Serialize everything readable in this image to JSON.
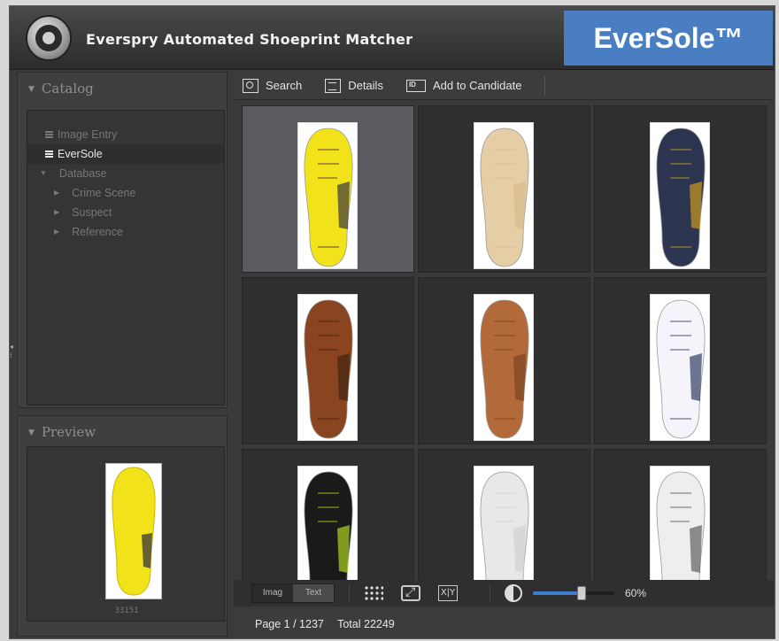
{
  "header": {
    "app_title": "Everspry Automated Shoeprint Matcher",
    "brand": "EverSole™"
  },
  "catalog": {
    "title": "Catalog",
    "items": [
      {
        "label": "Image Entry",
        "type": "db",
        "selected": false
      },
      {
        "label": "EverSole",
        "type": "db",
        "selected": true
      },
      {
        "label": "Database",
        "type": "group",
        "selected": false
      },
      {
        "label": "Crime Scene",
        "type": "child",
        "selected": false
      },
      {
        "label": "Suspect",
        "type": "child",
        "selected": false
      },
      {
        "label": "Reference",
        "type": "child",
        "selected": false
      }
    ]
  },
  "preview": {
    "title": "Preview",
    "caption": "33151"
  },
  "toolbar": {
    "search": "Search",
    "details": "Details",
    "add_candidate": "Add to Candidate"
  },
  "grid": {
    "items": [
      {
        "name": "shoeprint-1",
        "sole": "#f2e21a",
        "accent": "#2b2b40",
        "selected": true
      },
      {
        "name": "shoeprint-2",
        "sole": "#e5cda6",
        "accent": "#d9b88a",
        "selected": false
      },
      {
        "name": "shoeprint-3",
        "sole": "#2b3550",
        "accent": "#d8a018",
        "selected": false
      },
      {
        "name": "shoeprint-4",
        "sole": "#8a4520",
        "accent": "#3a2010",
        "selected": false
      },
      {
        "name": "shoeprint-5",
        "sole": "#b26a3a",
        "accent": "#7a4020",
        "selected": false
      },
      {
        "name": "shoeprint-6",
        "sole": "#f4f4fa",
        "accent": "#25305a",
        "selected": false
      },
      {
        "name": "shoeprint-7",
        "sole": "#1a1a1a",
        "accent": "#b7e020",
        "selected": false
      },
      {
        "name": "shoeprint-8",
        "sole": "#e8e8e8",
        "accent": "#cfcfcf",
        "selected": false
      },
      {
        "name": "shoeprint-9",
        "sole": "#eeeeee",
        "accent": "#555555",
        "selected": false
      }
    ]
  },
  "view_toggle": {
    "image": "Imag",
    "text": "Text"
  },
  "zoom": {
    "label": "60%",
    "value": 0.6
  },
  "status": {
    "page": "Page 1 / 1237",
    "total": "Total 22249"
  },
  "colors": {
    "brand_badge": "#4a7ec2",
    "slider_fill": "#3f7fd0"
  }
}
